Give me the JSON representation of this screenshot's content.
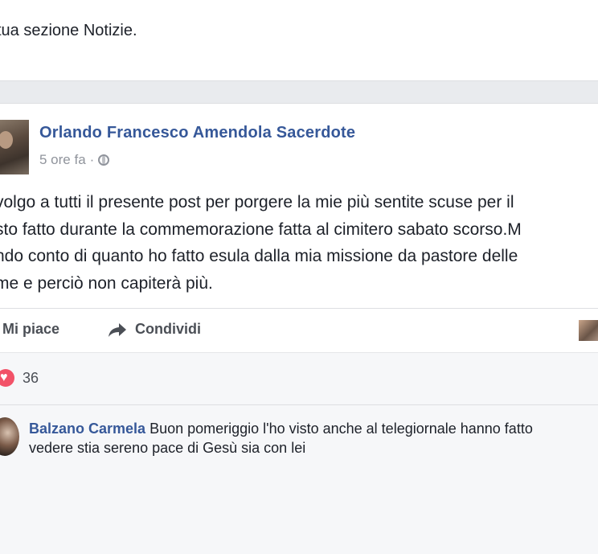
{
  "notice": {
    "text": "tua sezione Notizie."
  },
  "post": {
    "author": "Orlando Francesco Amendola Sacerdote",
    "time": "5 ore fa",
    "separator": "·",
    "privacy_icon": "globe-icon",
    "body_lines": [
      "volgo a tutti il presente post per porgere la mie più sentite scuse per il",
      "sto fatto durante la commemorazione fatta al cimitero sabato scorso.M",
      "ndo conto di quanto ho fatto esula dalla mia missione da pastore delle",
      "me e perciò non capiterà più."
    ],
    "actions": {
      "like": "Mi piace",
      "share": "Condividi"
    },
    "reactions": {
      "icon": "heart-icon",
      "count": "36"
    }
  },
  "comment": {
    "name": "Balzano Carmela",
    "text": " Buon pomeriggio l'ho visto anche al telegiornale hanno fatto",
    "text2": "vedere stia sereno pace di Gesù sia con lei"
  },
  "colors": {
    "link": "#365899",
    "secondary": "#90949c",
    "heart": "#f25268"
  }
}
